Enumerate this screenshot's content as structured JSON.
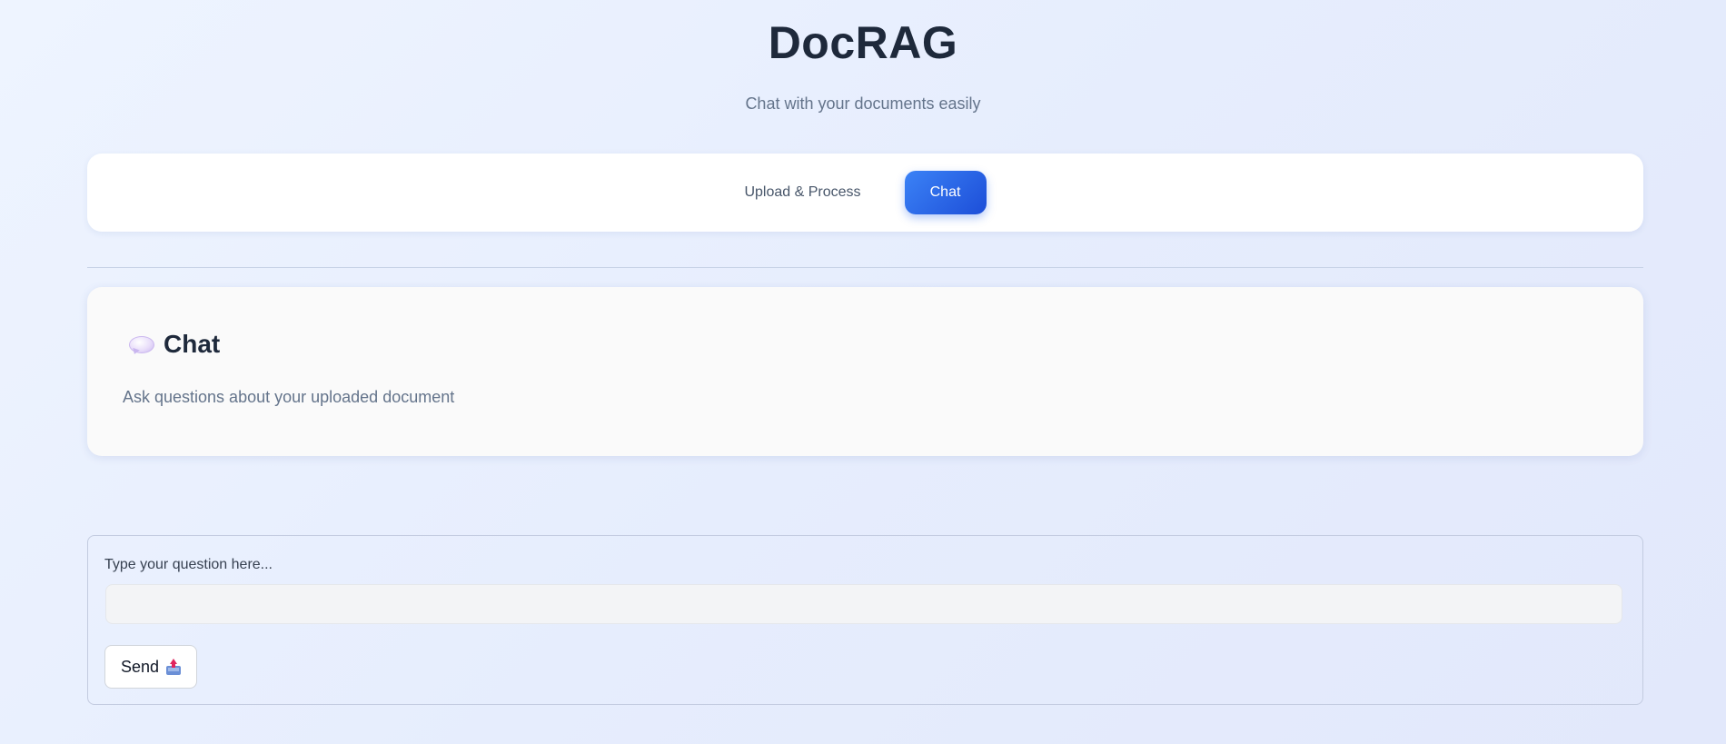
{
  "app": {
    "title": "DocRAG",
    "subtitle": "Chat with your documents easily"
  },
  "tabs": [
    {
      "label": "Upload & Process",
      "active": false
    },
    {
      "label": "Chat",
      "active": true
    }
  ],
  "chat_section": {
    "icon": "speech-balloon-icon",
    "heading": "Chat",
    "description": "Ask questions about your uploaded document"
  },
  "question": {
    "label": "Type your question here...",
    "value": "",
    "placeholder": ""
  },
  "send_button": {
    "label": "Send",
    "icon": "outbox-tray-icon"
  },
  "colors": {
    "accent": "#2563eb",
    "title": "#1e293b",
    "muted": "#64748b"
  }
}
